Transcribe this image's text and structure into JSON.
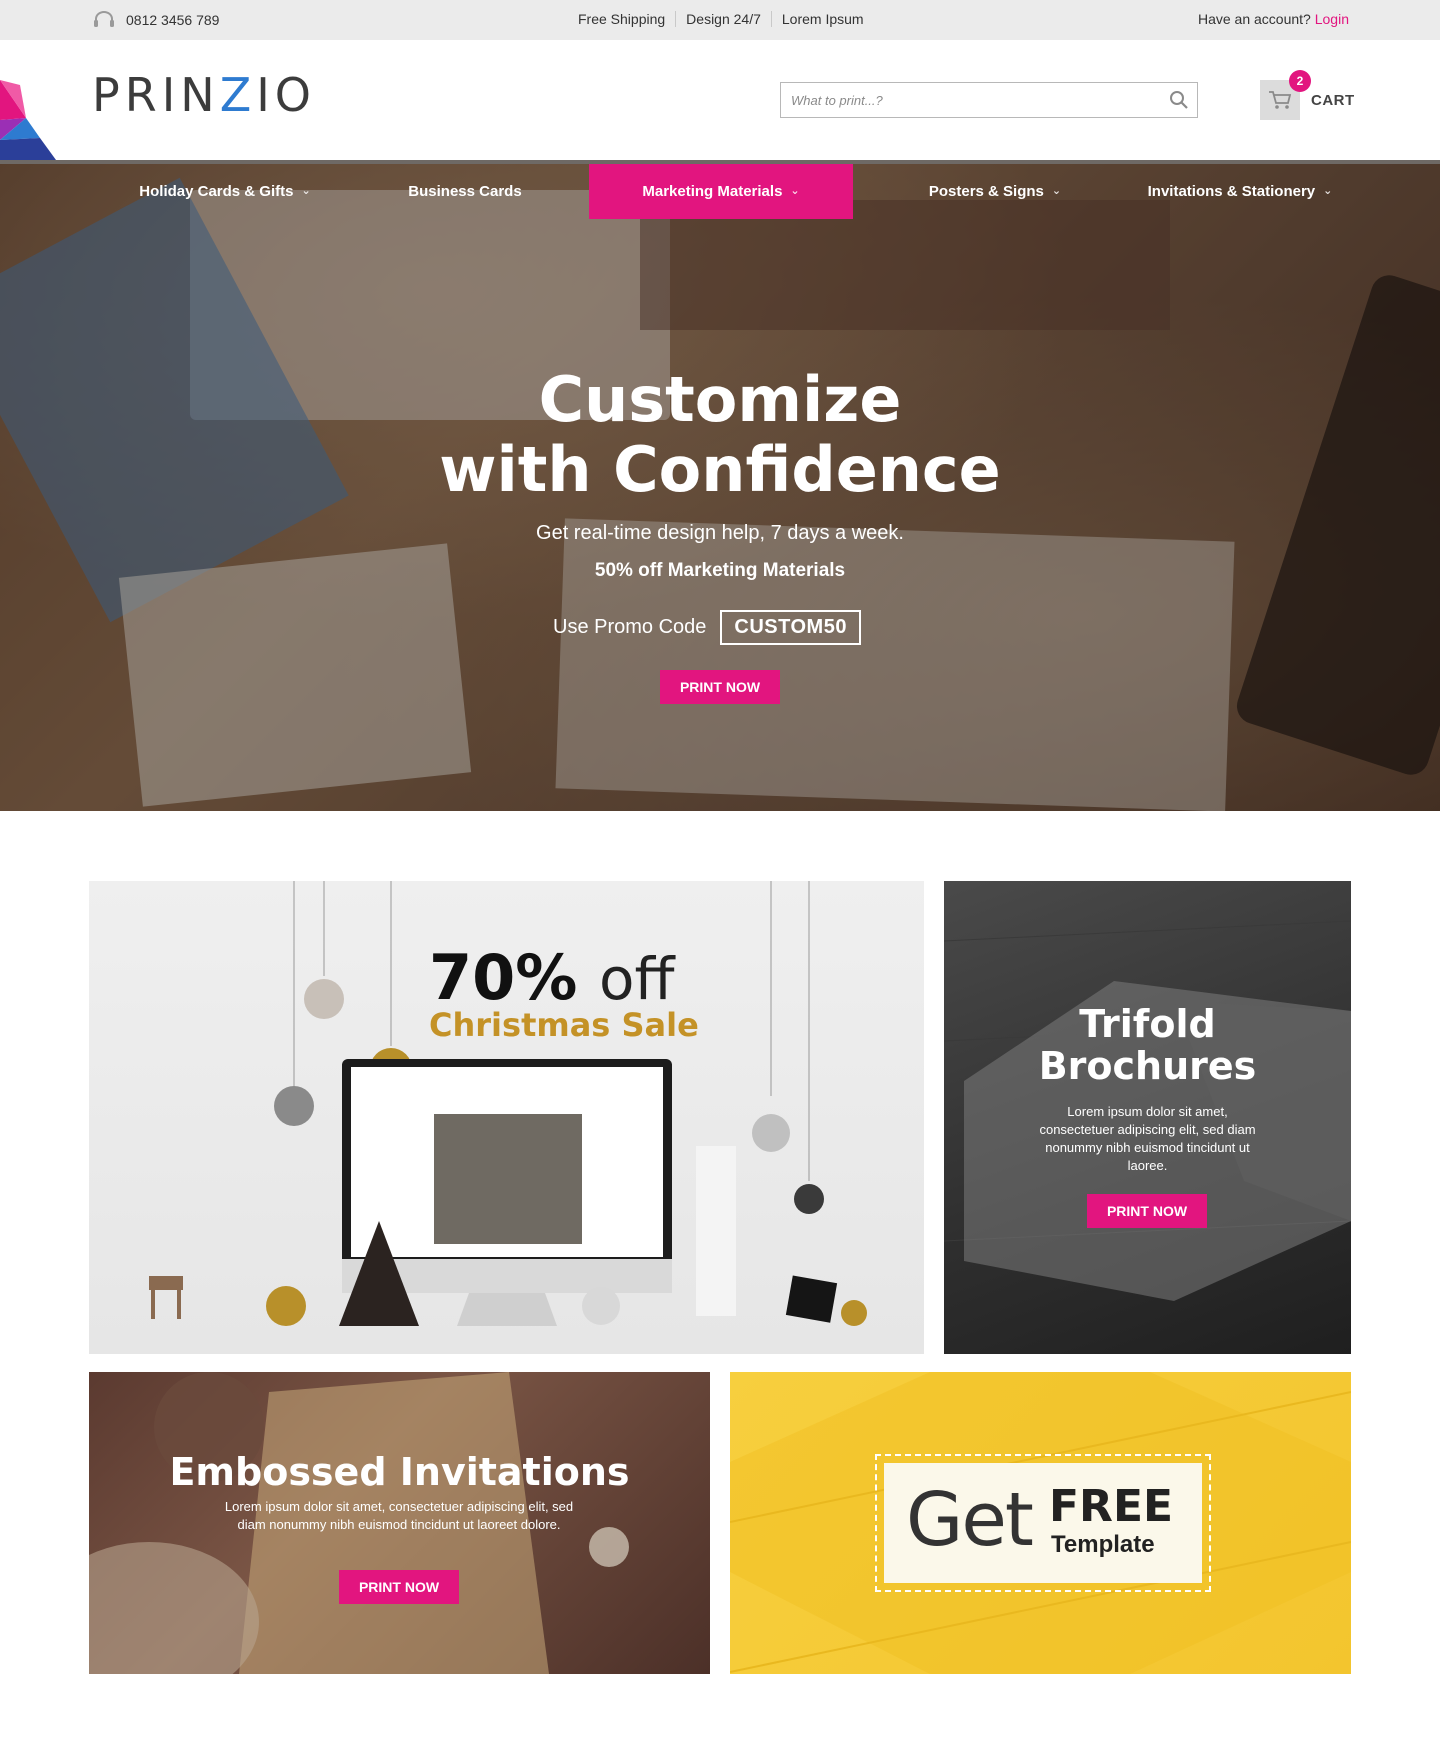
{
  "topbar": {
    "phone": "0812 3456 789",
    "links": [
      "Free Shipping",
      "Design 24/7",
      "Lorem Ipsum"
    ],
    "account_text": "Have an account?",
    "login_label": "Login"
  },
  "header": {
    "logo_pre": "PRIN",
    "logo_z": "Z",
    "logo_post": "IO",
    "search_placeholder": "What to print...?",
    "cart_count": "2",
    "cart_label": "CART"
  },
  "nav": {
    "items": [
      {
        "label": "Holiday Cards & Gifts",
        "dropdown": true
      },
      {
        "label": "Business Cards",
        "dropdown": false
      },
      {
        "label": "Marketing Materials",
        "dropdown": true,
        "active": true
      },
      {
        "label": "Posters & Signs",
        "dropdown": true
      },
      {
        "label": "Invitations & Stationery",
        "dropdown": true
      }
    ]
  },
  "hero": {
    "title_line1": "Customize",
    "title_line2": "with Confidence",
    "subtitle": "Get real-time design help, 7 days a week.",
    "offer": "50% off Marketing Materials",
    "promo_label": "Use Promo Code",
    "promo_code": "CUSTOM50",
    "button": "PRINT NOW"
  },
  "tiles": {
    "xmas": {
      "percent": "70%",
      "off": "off",
      "sale": "Christmas Sale"
    },
    "trifold": {
      "title_line1": "Trifold",
      "title_line2": "Brochures",
      "text": "Lorem ipsum dolor sit amet, consectetuer adipiscing elit, sed diam nonummy nibh euismod tincidunt ut laoree.",
      "button": "PRINT NOW"
    },
    "emboss": {
      "title": "Embossed Invitations",
      "text": "Lorem ipsum dolor sit amet, consectetuer adipiscing elit, sed diam nonummy nibh euismod tincidunt ut laoreet dolore.",
      "button": "PRINT NOW"
    },
    "free": {
      "get": "Get",
      "free": "FREE",
      "template": "Template"
    }
  },
  "colors": {
    "accent": "#e2157f",
    "topbar_bg": "#ebebeb",
    "sale_gold": "#c49227",
    "free_yellow": "#f5cb36"
  },
  "icons": [
    "headset-icon",
    "search-icon",
    "cart-icon",
    "chevron-down-icon"
  ]
}
